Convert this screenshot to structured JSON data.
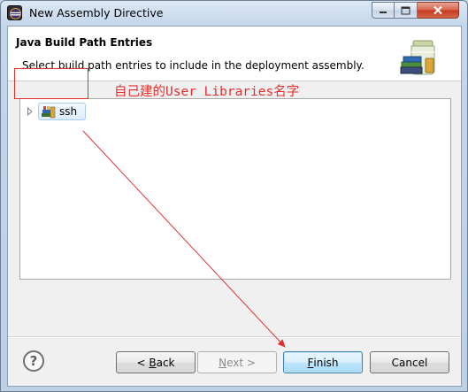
{
  "window": {
    "title": "New Assembly Directive",
    "icons": {
      "app": "eclipse-icon",
      "minimize": "minimize-icon",
      "maximize": "maximize-icon",
      "close": "close-icon"
    }
  },
  "header": {
    "title": "Java Build Path Entries",
    "description": "Select build path entries to include in the deployment assembly.",
    "image": "library-jar-icon"
  },
  "tree": {
    "items": [
      {
        "label": "ssh",
        "icon": "user-library-icon",
        "expanded": false
      }
    ]
  },
  "annotation": {
    "text": "自己建的User Libraries名字",
    "color": "#e52d2d"
  },
  "buttons": {
    "help": "?",
    "back": {
      "prefix": "< ",
      "mnemonic": "B",
      "rest": "ack"
    },
    "next": {
      "mnemonic": "N",
      "rest": "ext >",
      "enabled": false
    },
    "finish": {
      "mnemonic": "F",
      "rest": "inish"
    },
    "cancel": "Cancel"
  }
}
